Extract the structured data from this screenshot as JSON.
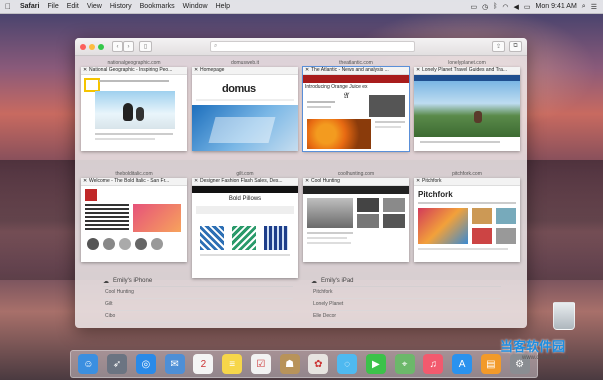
{
  "menubar": {
    "app": "Safari",
    "menus": [
      "File",
      "Edit",
      "View",
      "History",
      "Bookmarks",
      "Window",
      "Help"
    ],
    "clock": "Mon 9:41 AM"
  },
  "browser": {
    "address_placeholder": "",
    "tiles": [
      {
        "domain": "nationalgeographic.com",
        "title": "National Geographic - Inspiring Peo..."
      },
      {
        "domain": "domusweb.it",
        "title": "Homepage",
        "logo": "domus"
      },
      {
        "domain": "theatlantic.com",
        "title": "The Atlantic - News and analysis ...",
        "headline": "Introducing Orange Juice ex"
      },
      {
        "domain": "lonelyplanet.com",
        "title": "Lonely Planet Travel Guides and Tra..."
      },
      {
        "domain": "thebolditalic.com",
        "title": "Welcome - The Bold Italic - San Fr..."
      },
      {
        "domain": "gilt.com",
        "title": "Designer Fashion Flash Sales, Des...",
        "subtitle": "Bold Pillows"
      },
      {
        "domain": "coolhunting.com",
        "title": "Cool Hunting"
      },
      {
        "domain": "pitchfork.com",
        "title": "Pitchfork",
        "logo": "Pitchfork"
      }
    ],
    "icloud": [
      {
        "device": "Emily's iPhone",
        "items": [
          "Cool Hunting",
          "Gilt",
          "Cibo"
        ]
      },
      {
        "device": "Emily's iPad",
        "items": [
          "Pitchfork",
          "Lonely Planet",
          "Elle Decor"
        ]
      }
    ]
  },
  "dock": {
    "apps": [
      {
        "name": "finder",
        "color": "#3b8fe0"
      },
      {
        "name": "launchpad",
        "color": "#6b7482"
      },
      {
        "name": "safari",
        "color": "#2a8ae8"
      },
      {
        "name": "mail",
        "color": "#4e8fd6"
      },
      {
        "name": "calendar",
        "color": "#f4f4f4"
      },
      {
        "name": "notes",
        "color": "#f6d64a"
      },
      {
        "name": "reminders",
        "color": "#f2f2f2"
      },
      {
        "name": "contacts",
        "color": "#b8935a"
      },
      {
        "name": "photos",
        "color": "#e7e4e0"
      },
      {
        "name": "messages",
        "color": "#4fb9f0"
      },
      {
        "name": "facetime",
        "color": "#3cc24a"
      },
      {
        "name": "maps",
        "color": "#6cb86a"
      },
      {
        "name": "itunes",
        "color": "#f25a6e"
      },
      {
        "name": "app-store",
        "color": "#2a92ee"
      },
      {
        "name": "ibooks",
        "color": "#f29a2a"
      },
      {
        "name": "system-preferences",
        "color": "#8a8d92"
      }
    ]
  },
  "watermark": {
    "text": "当客软件园",
    "url": "www.downkr.com"
  }
}
